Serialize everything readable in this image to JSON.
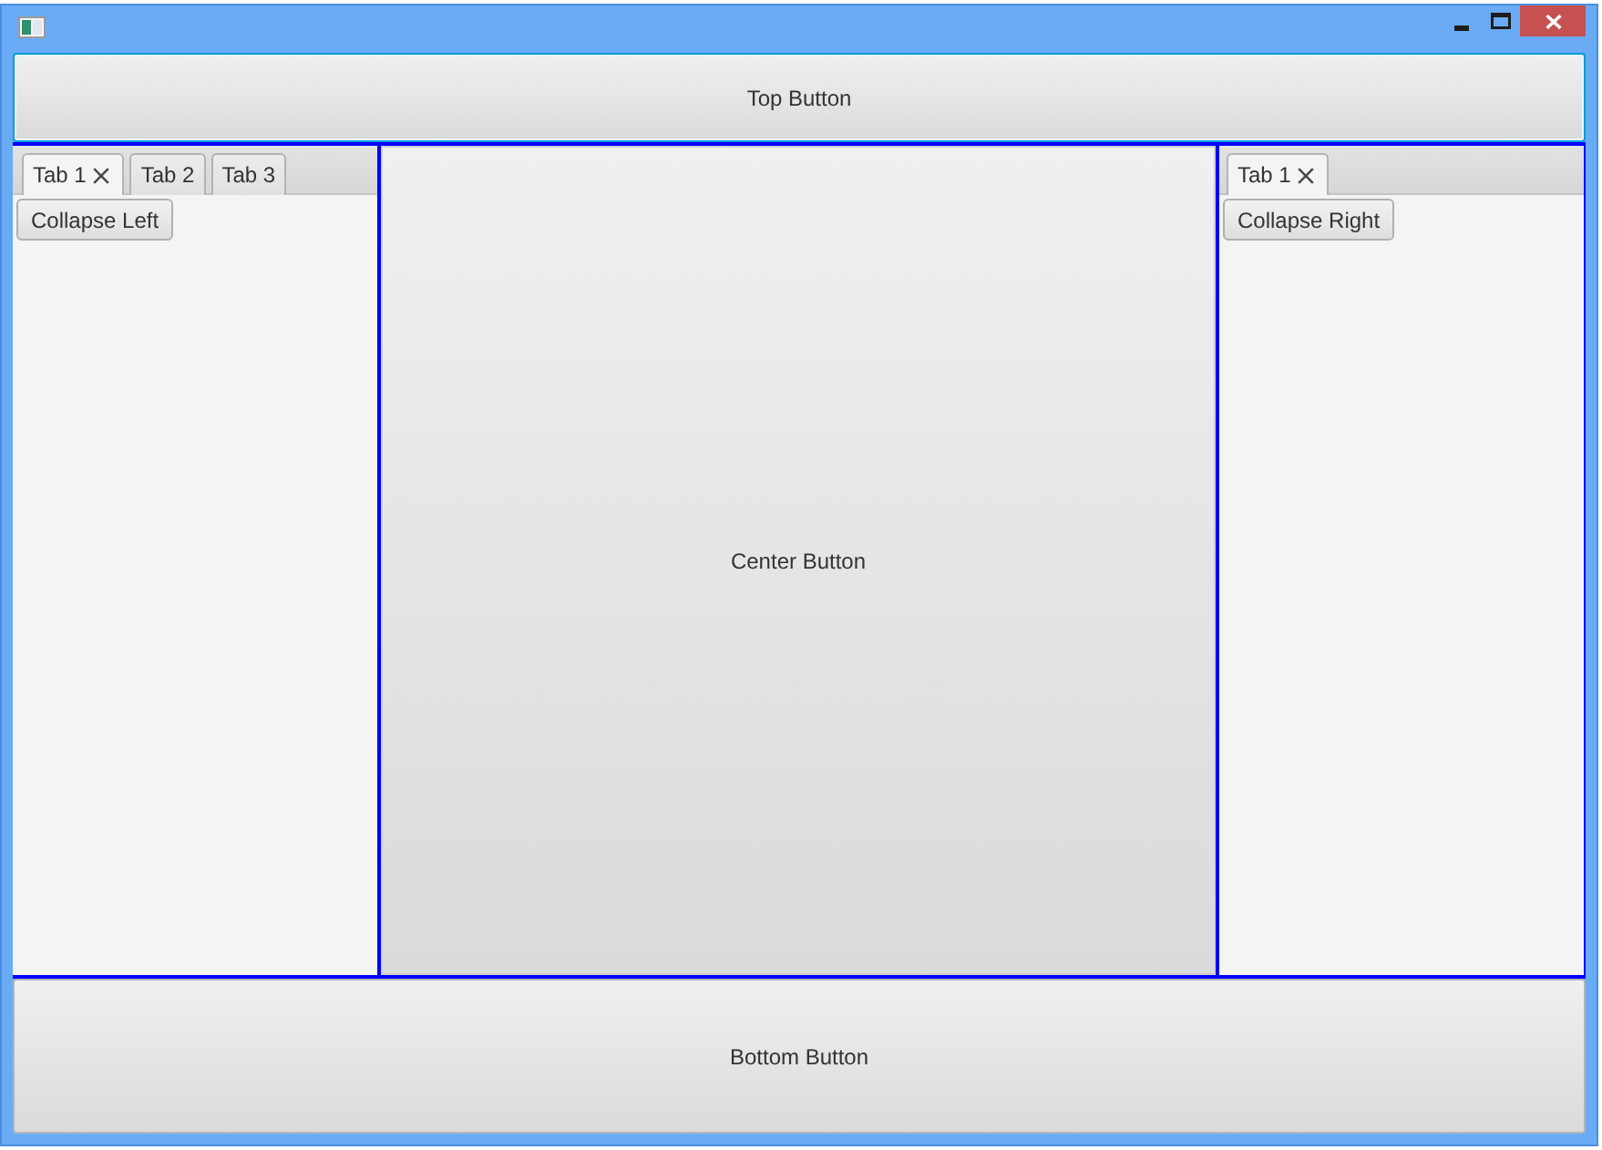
{
  "top_button": {
    "label": "Top Button",
    "focused": true
  },
  "left_pane": {
    "tabs": [
      {
        "label": "Tab 1",
        "selected": true,
        "closable": true
      },
      {
        "label": "Tab 2",
        "selected": false,
        "closable": false
      },
      {
        "label": "Tab 3",
        "selected": false,
        "closable": false
      }
    ],
    "button": {
      "label": "Collapse Left"
    }
  },
  "center_button": {
    "label": "Center Button",
    "focused": false
  },
  "right_pane": {
    "tabs": [
      {
        "label": "Tab 1",
        "selected": true,
        "closable": true
      }
    ],
    "button": {
      "label": "Collapse Right"
    }
  },
  "bottom_button": {
    "label": "Bottom Button",
    "focused": false
  }
}
